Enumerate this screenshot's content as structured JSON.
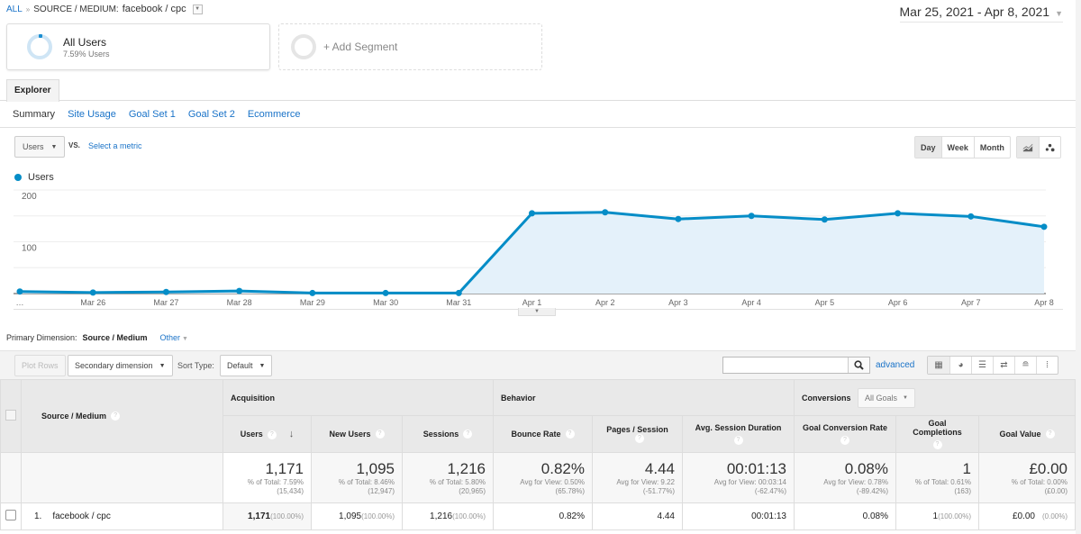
{
  "breadcrumb": {
    "root": "ALL",
    "separator": "»",
    "label": "SOURCE / MEDIUM:",
    "value": "facebook / cpc"
  },
  "date_range": "Mar 25, 2021 - Apr 8, 2021",
  "segments": [
    {
      "title": "All Users",
      "subtitle": "7.59% Users"
    },
    {
      "title": "+ Add Segment"
    }
  ],
  "tabs": {
    "explorer": "Explorer"
  },
  "subtabs": [
    "Summary",
    "Site Usage",
    "Goal Set 1",
    "Goal Set 2",
    "Ecommerce"
  ],
  "metric_selector": {
    "value": "Users",
    "vs": "VS.",
    "select_metric": "Select a metric"
  },
  "period_buttons": [
    "Day",
    "Week",
    "Month"
  ],
  "period_active": "Day",
  "chart_type_buttons": [
    "line-chart-icon",
    "motion-chart-icon"
  ],
  "chart_data": {
    "type": "area",
    "legend": [
      "Users"
    ],
    "legend_position": "top-left",
    "x": [
      "…",
      "Mar 26",
      "Mar 27",
      "Mar 28",
      "Mar 29",
      "Mar 30",
      "Mar 31",
      "Apr 1",
      "Apr 2",
      "Apr 3",
      "Apr 4",
      "Apr 5",
      "Apr 6",
      "Apr 7",
      "Apr 8"
    ],
    "series": [
      {
        "name": "Users",
        "values": [
          4,
          2,
          3,
          5,
          1,
          1,
          1,
          155,
          157,
          144,
          150,
          143,
          155,
          149,
          129
        ],
        "color": "#058dc7"
      }
    ],
    "yticks": [
      100,
      200
    ],
    "ylim": [
      0,
      200
    ],
    "grid": true
  },
  "primary_dimension": {
    "label": "Primary Dimension:",
    "value": "Source / Medium",
    "other": "Other"
  },
  "toolbar": {
    "plot_rows": "Plot Rows",
    "secondary_dimension": "Secondary dimension",
    "sort_type_label": "Sort Type:",
    "sort_type": "Default",
    "search_placeholder": "",
    "advanced": "advanced"
  },
  "table": {
    "dimension_header": "Source / Medium",
    "groups": {
      "acquisition": "Acquisition",
      "behavior": "Behavior",
      "conversions": "Conversions",
      "goals_select": "All Goals"
    },
    "columns": [
      "Users",
      "New Users",
      "Sessions",
      "Bounce Rate",
      "Pages / Session",
      "Avg. Session Duration",
      "Goal Conversion Rate",
      "Goal Completions",
      "Goal Value"
    ],
    "totals": [
      {
        "value": "1,171",
        "line1": "% of Total: 7.59%",
        "line2": "(15,434)"
      },
      {
        "value": "1,095",
        "line1": "% of Total: 8.46%",
        "line2": "(12,947)"
      },
      {
        "value": "1,216",
        "line1": "% of Total: 5.80%",
        "line2": "(20,965)"
      },
      {
        "value": "0.82%",
        "line1": "Avg for View: 0.50%",
        "line2": "(65.78%)"
      },
      {
        "value": "4.44",
        "line1": "Avg for View: 9.22",
        "line2": "(-51.77%)"
      },
      {
        "value": "00:01:13",
        "line1": "Avg for View: 00:03:14",
        "line2": "(-62.47%)"
      },
      {
        "value": "0.08%",
        "line1": "Avg for View: 0.78%",
        "line2": "(-89.42%)"
      },
      {
        "value": "1",
        "line1": "% of Total: 0.61%",
        "line2": "(163)"
      },
      {
        "value": "£0.00",
        "line1": "% of Total: 0.00%",
        "line2": "(£0.00)"
      }
    ],
    "rows": [
      {
        "index": "1.",
        "dimension": "facebook / cpc",
        "cells": [
          {
            "value": "1,171",
            "pct": "(100.00%)"
          },
          {
            "value": "1,095",
            "pct": "(100.00%)"
          },
          {
            "value": "1,216",
            "pct": "(100.00%)"
          },
          {
            "value": "0.82%",
            "pct": ""
          },
          {
            "value": "4.44",
            "pct": ""
          },
          {
            "value": "00:01:13",
            "pct": ""
          },
          {
            "value": "0.08%",
            "pct": ""
          },
          {
            "value": "1",
            "pct": "(100.00%)"
          },
          {
            "value": "£0.00",
            "pct": "(0.00%)"
          }
        ]
      }
    ]
  }
}
